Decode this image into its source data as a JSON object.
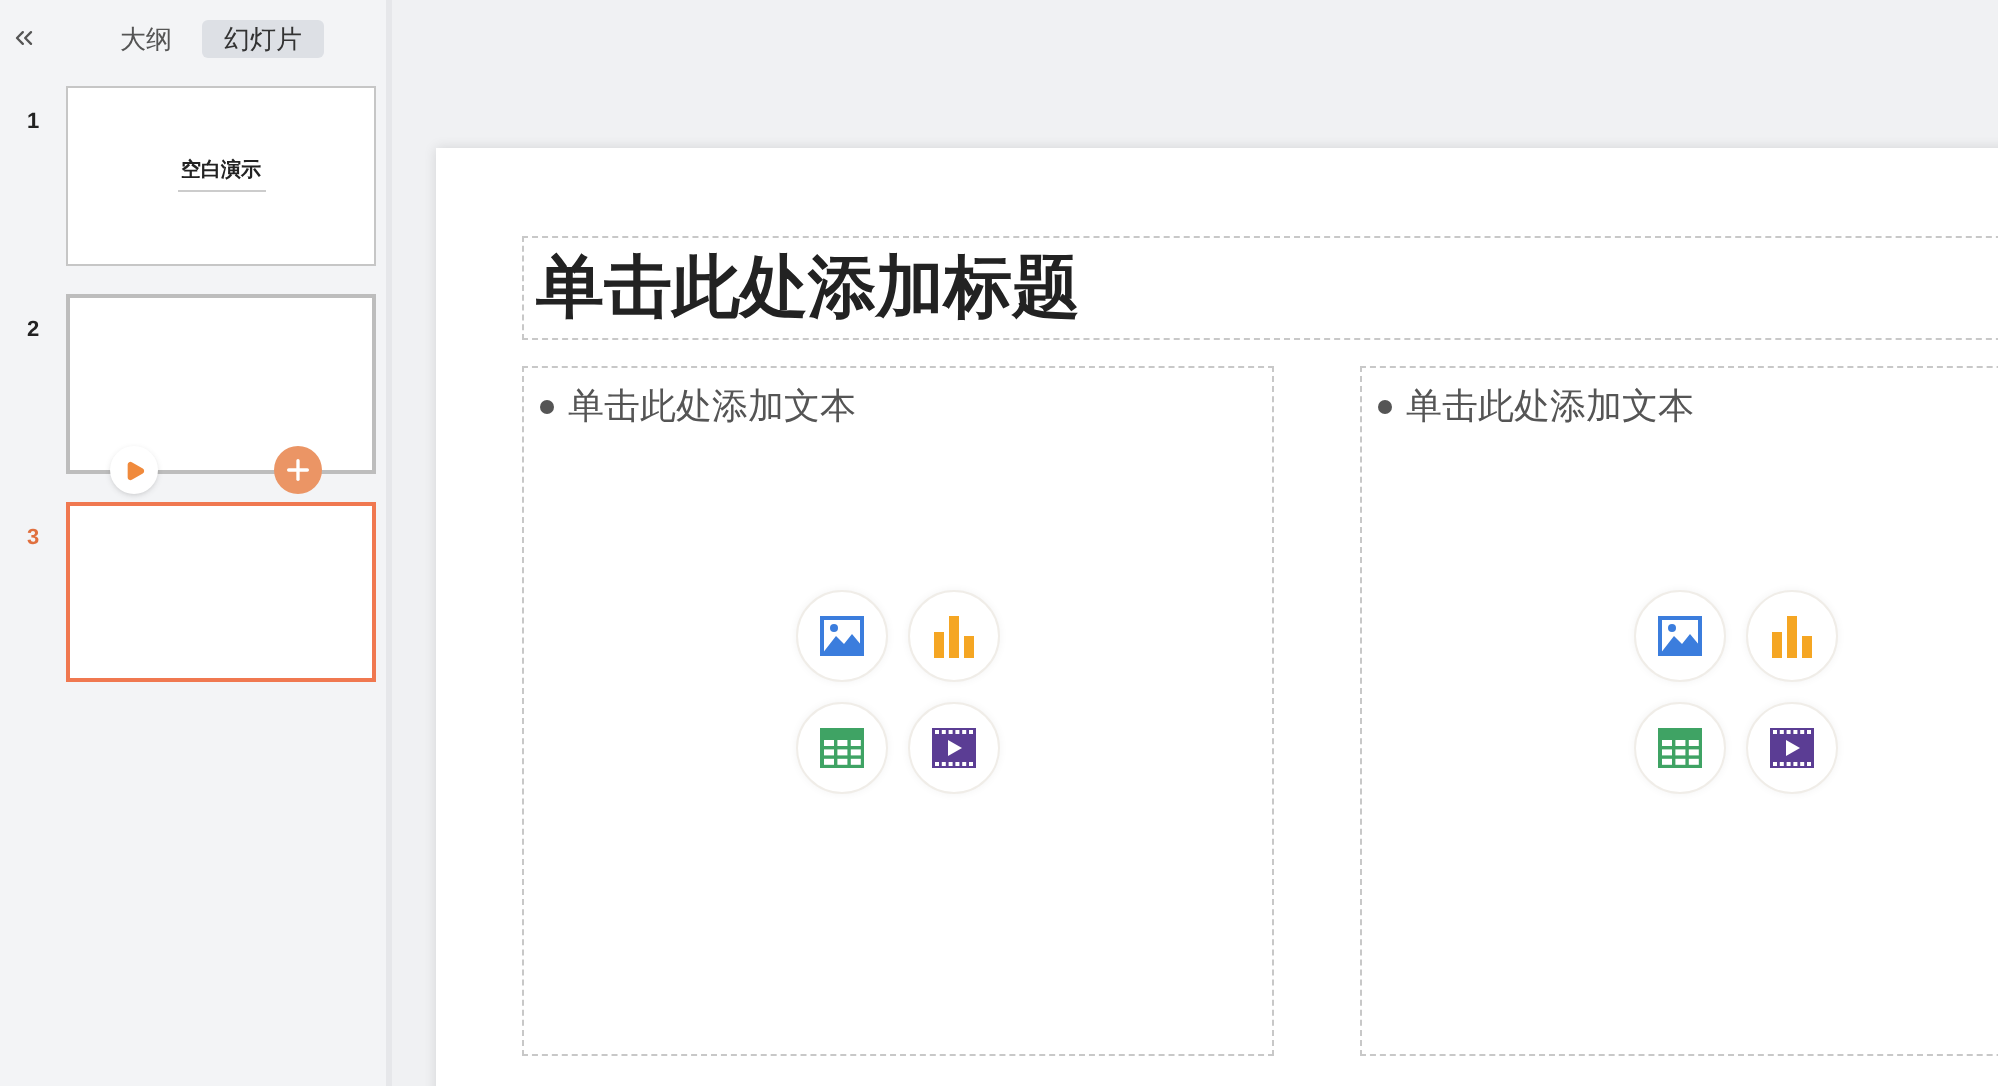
{
  "sidebar": {
    "tabs": [
      {
        "label": "大纲",
        "selected": false
      },
      {
        "label": "幻灯片",
        "selected": true
      }
    ],
    "slides": [
      {
        "number": "1",
        "selected": false,
        "hovered": false,
        "title": "空白演示"
      },
      {
        "number": "2",
        "selected": false,
        "hovered": true
      },
      {
        "number": "3",
        "selected": true,
        "hovered": false
      }
    ]
  },
  "slide": {
    "title_placeholder": "单击此处添加标题",
    "content_boxes": [
      {
        "placeholder": "单击此处添加文本"
      },
      {
        "placeholder": "单击此处添加文本"
      }
    ]
  }
}
